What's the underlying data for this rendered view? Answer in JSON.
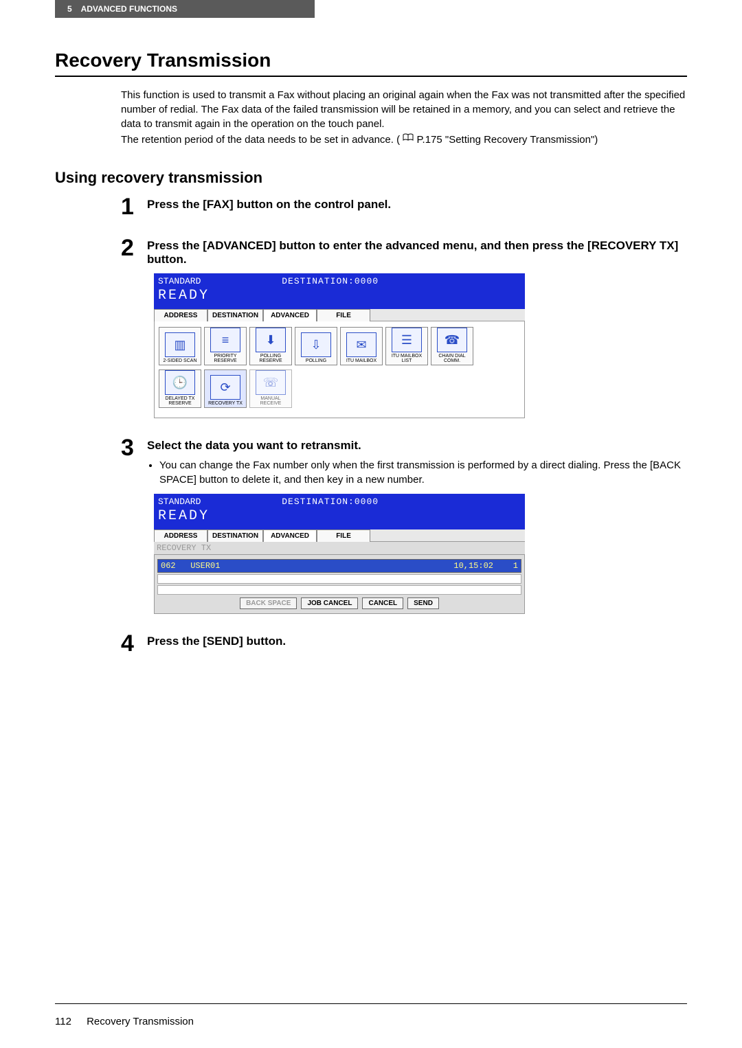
{
  "header": {
    "chapter_num": "5",
    "chapter_title": "ADVANCED FUNCTIONS"
  },
  "title": "Recovery Transmission",
  "intro": {
    "p1": "This function is used to transmit a Fax without placing an original again when the Fax was not transmitted after the specified number of redial. The Fax data of the failed transmission will be retained in a memory, and you can select and retrieve the data to transmit again in the operation on the touch panel.",
    "p2_pre": "The retention period of the data needs to be set in advance. (",
    "p2_ref": " P.175 \"Setting Recovery Transmission\")"
  },
  "subtitle": "Using recovery transmission",
  "steps": [
    {
      "num": "1",
      "heading": "Press the [FAX] button on the control panel."
    },
    {
      "num": "2",
      "heading": "Press the [ADVANCED] button to enter the advanced menu, and then press the [RECOVERY TX] button."
    },
    {
      "num": "3",
      "heading": "Select the data you want to retransmit.",
      "note": "You can change the Fax number only when the first transmission is performed by a direct dialing. Press the [BACK SPACE] button to delete it, and then key in a new number."
    },
    {
      "num": "4",
      "heading": "Press the [SEND] button."
    }
  ],
  "screen1": {
    "standard": "STANDARD",
    "destination": "DESTINATION:0000",
    "ready": "READY",
    "tabs": [
      "ADDRESS",
      "DESTINATION",
      "ADVANCED",
      "FILE"
    ],
    "row1": [
      "2-SIDED SCAN",
      "PRIORITY RESERVE",
      "POLLING RESERVE",
      "POLLING",
      "ITU MAILBOX",
      "ITU MAILBOX LIST",
      "CHAIN DIAL COMM."
    ],
    "row2": [
      "DELAYED TX RESERVE",
      "RECOVERY TX",
      "MANUAL RECEIVE"
    ]
  },
  "screen2": {
    "standard": "STANDARD",
    "destination": "DESTINATION:0000",
    "ready": "READY",
    "tabs": [
      "ADDRESS",
      "DESTINATION",
      "ADVANCED",
      "FILE"
    ],
    "mode": "RECOVERY TX",
    "item_code": "062",
    "item_user": "USER01",
    "item_time": "10,15:02",
    "item_pg": "1",
    "buttons": [
      "BACK SPACE",
      "JOB CANCEL",
      "CANCEL",
      "SEND"
    ]
  },
  "footer": {
    "page": "112",
    "title": "Recovery Transmission"
  }
}
